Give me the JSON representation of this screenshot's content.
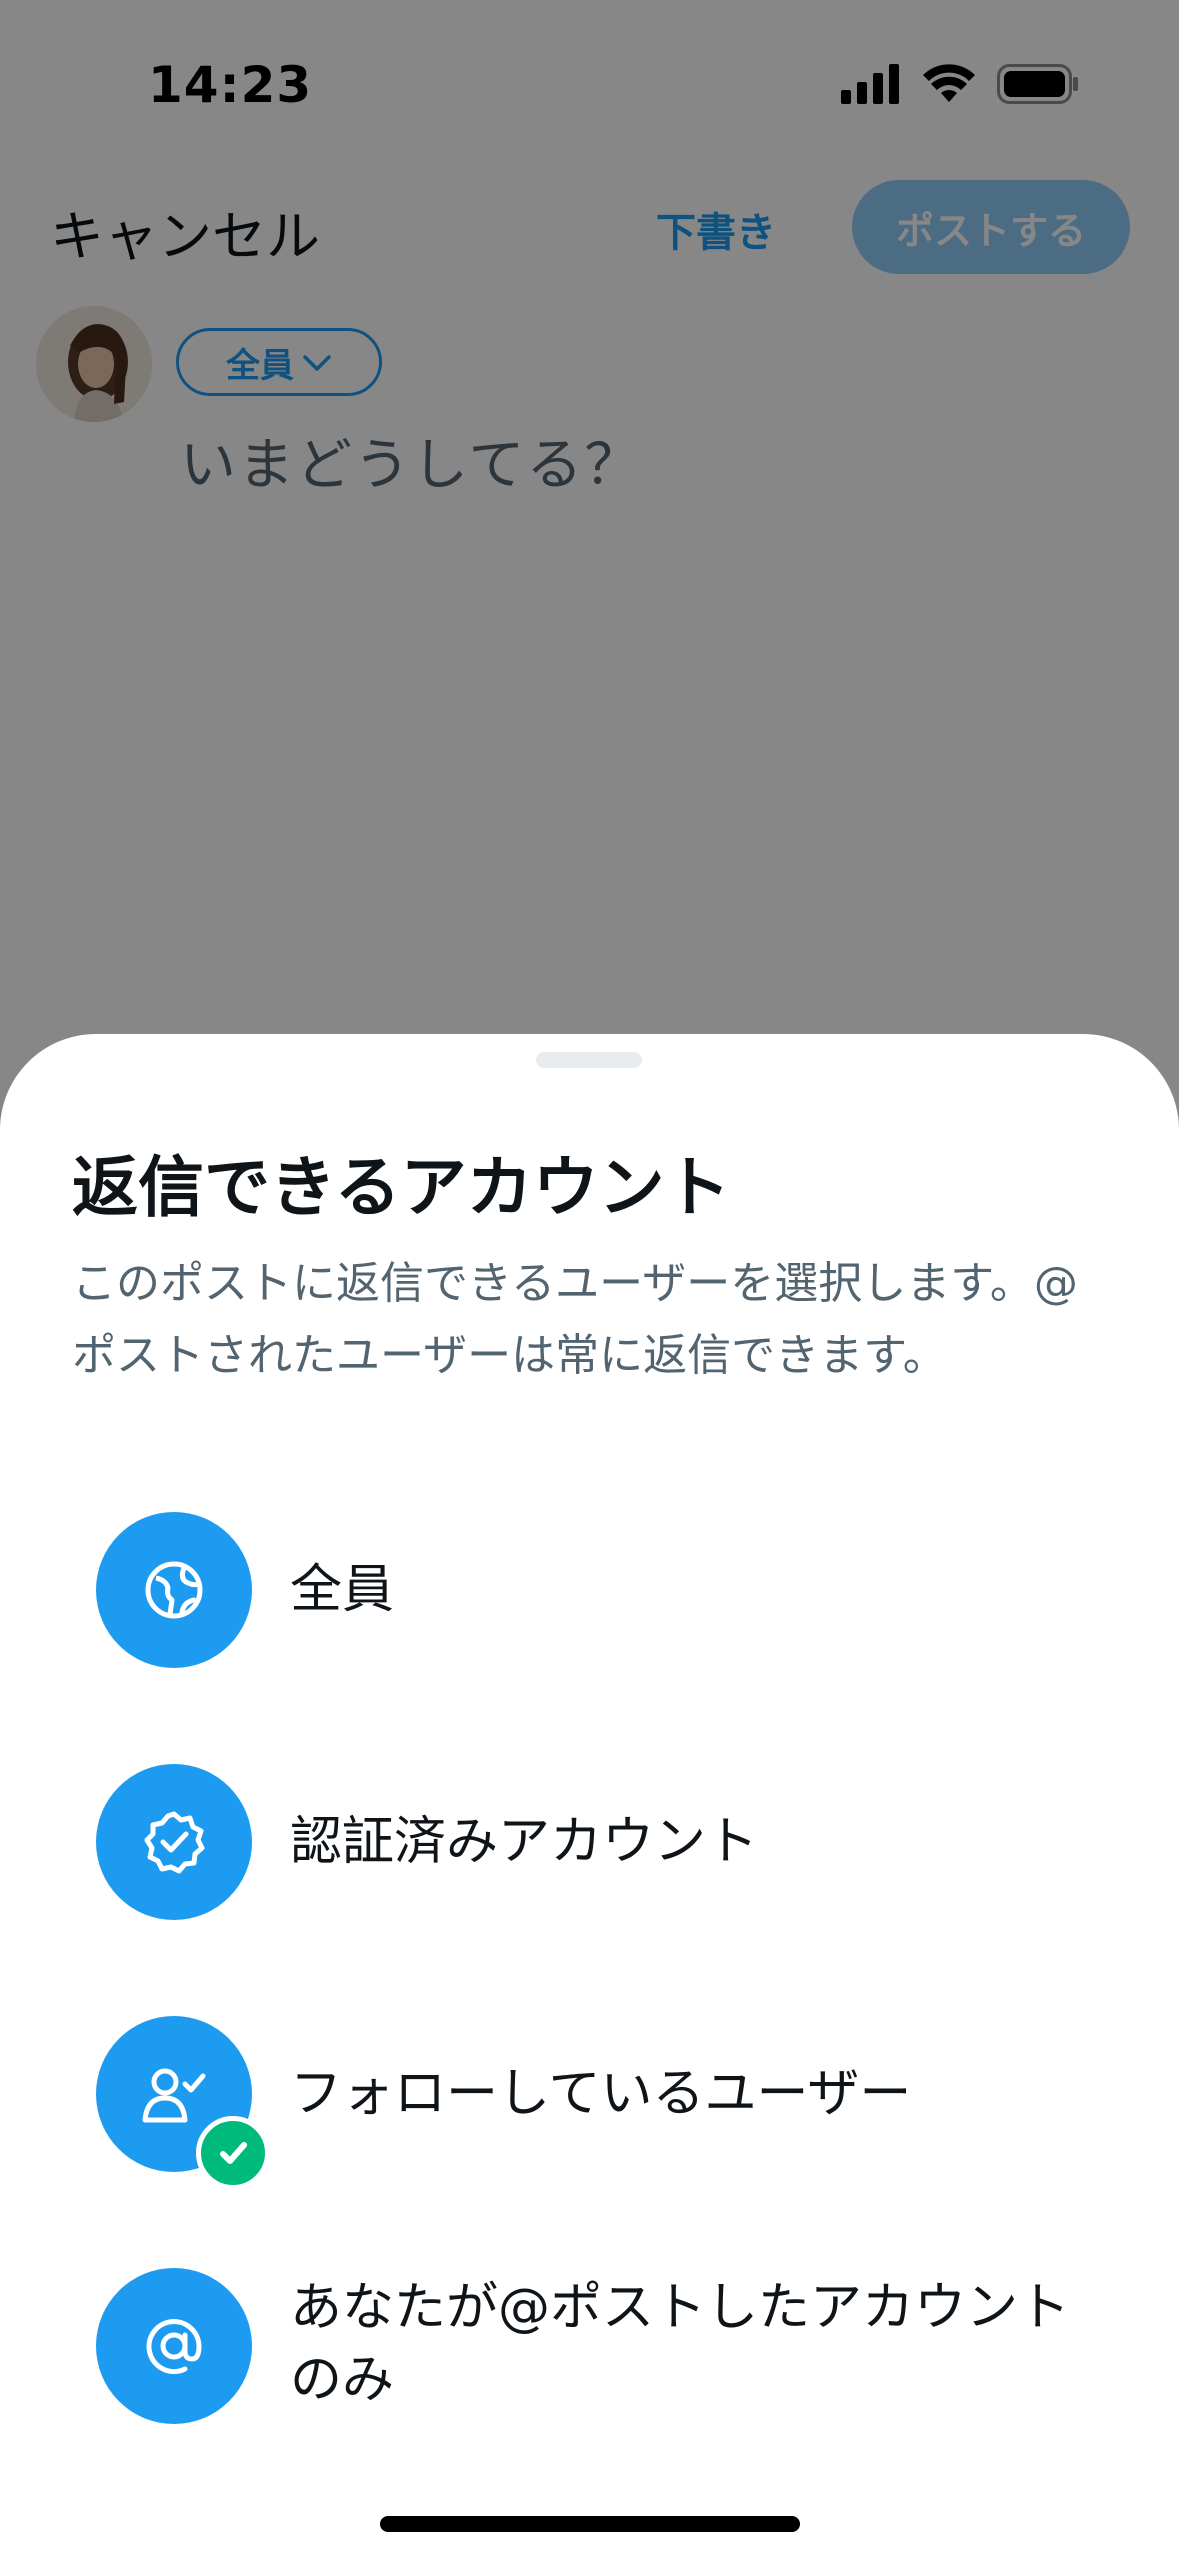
{
  "status_bar": {
    "time": "14:23",
    "icons": [
      "signal-icon",
      "wifi-icon",
      "battery-icon"
    ]
  },
  "composer": {
    "cancel_label": "キャンセル",
    "draft_label": "下書き",
    "post_label": "ポストする",
    "audience_label": "全員",
    "placeholder": "いまどうしてる？"
  },
  "sheet": {
    "title": "返信できるアカウント",
    "description": "このポストに返信できるユーザーを選択します。@ポストされたユーザーは常に返信できます。",
    "options": [
      {
        "label": "全員",
        "icon": "globe-icon",
        "selected": false
      },
      {
        "label": "認証済みアカウント",
        "icon": "verified-icon",
        "selected": false
      },
      {
        "label": "フォローしているユーザー",
        "icon": "people-check-icon",
        "selected": true
      },
      {
        "label": "あなたが@ポストしたアカウントのみ",
        "icon": "at-icon",
        "selected": false
      }
    ]
  },
  "colors": {
    "accent": "#1d9bf0",
    "post_button_disabled": "#8ecdf8",
    "selected_check": "#00ba7c",
    "text_primary": "#0f1419",
    "text_secondary": "#536471",
    "scrim": "rgba(0,0,0,0.47)"
  }
}
